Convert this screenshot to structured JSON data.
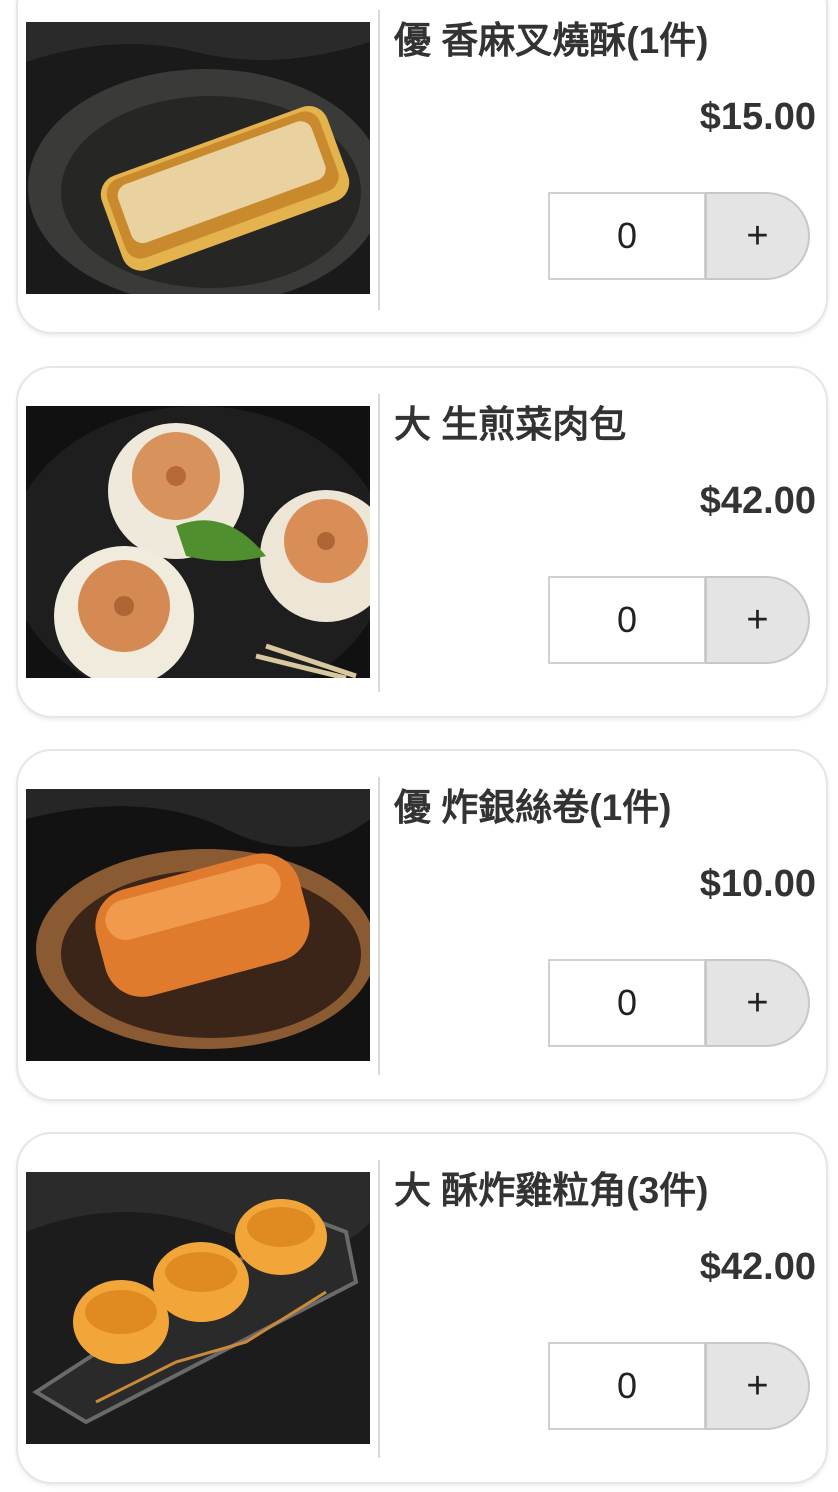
{
  "menu": {
    "items": [
      {
        "name": "優 香麻叉燒酥(1件)",
        "price": "$15.00",
        "quantity": "0",
        "add_label": "+"
      },
      {
        "name": "大 生煎菜肉包",
        "price": "$42.00",
        "quantity": "0",
        "add_label": "+"
      },
      {
        "name": "優 炸銀絲卷(1件)",
        "price": "$10.00",
        "quantity": "0",
        "add_label": "+"
      },
      {
        "name": "大 酥炸雞粒角(3件)",
        "price": "$42.00",
        "quantity": "0",
        "add_label": "+"
      }
    ]
  },
  "colors": {
    "text": "#333333",
    "card_border": "#e6e6e6",
    "plus_button_bg": "#e4e4e4"
  }
}
